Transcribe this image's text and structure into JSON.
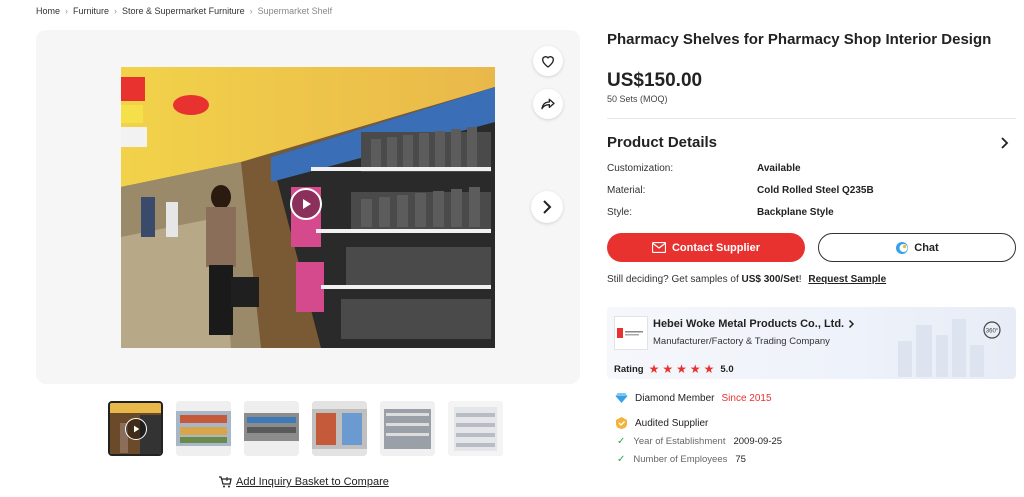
{
  "breadcrumb": {
    "items": [
      "Home",
      "Furniture",
      "Store & Supermarket Furniture",
      "Supermarket Shelf"
    ]
  },
  "product": {
    "title": "Pharmacy Shelves for Pharmacy Shop Interior Design",
    "price": "US$150.00",
    "moq": "50 Sets (MOQ)"
  },
  "details": {
    "heading": "Product Details",
    "rows": [
      {
        "label": "Customization:",
        "value": "Available"
      },
      {
        "label": "Material:",
        "value": "Cold Rolled Steel Q235B"
      },
      {
        "label": "Style:",
        "value": "Backplane Style"
      }
    ]
  },
  "actions": {
    "contact_label": "Contact Supplier",
    "chat_label": "Chat"
  },
  "sample": {
    "prefix": "Still deciding? Get samples of",
    "price": "US$ 300/Set",
    "suffix": "!",
    "link": "Request Sample"
  },
  "supplier": {
    "name": "Hebei Woke Metal Products Co., Ltd.",
    "type": "Manufacturer/Factory & Trading Company",
    "rating_label": "Rating",
    "rating_value": "5.0",
    "rating_stars": 5,
    "badge_360": "360°",
    "diamond_label": "Diamond Member",
    "diamond_since": "Since 2015",
    "audited_label": "Audited Supplier",
    "year_label": "Year of Establishment",
    "year_value": "2009-09-25",
    "employees_label": "Number of Employees",
    "employees_value": "75"
  },
  "gallery": {
    "thumbnail_count": 6,
    "compare_label": "Add Inquiry Basket to Compare"
  },
  "colors": {
    "accent": "#e8322f",
    "verified": "#2ba84a",
    "diamond": "#3aa0e6"
  }
}
